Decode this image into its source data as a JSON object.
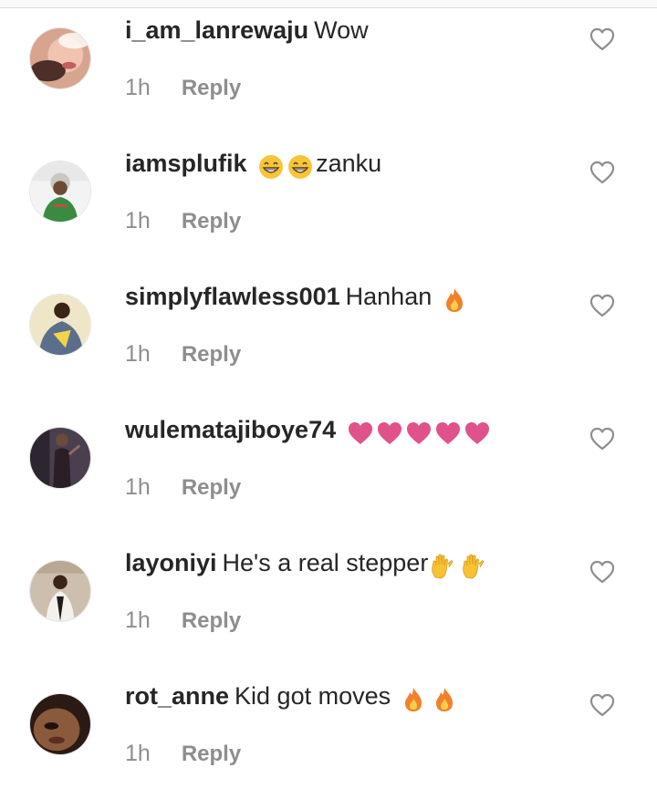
{
  "colors": {
    "username": "#262626",
    "text": "#262626",
    "meta": "#8e8e8e",
    "heart_outline": "#8e8e8e",
    "heart_emoji": "#e0528a",
    "fire": "#f2802a",
    "raised_hand": "#f7c234",
    "grin_emoji": "#f6c53a"
  },
  "comments": [
    {
      "username": "i_am_lanrewaju",
      "text": "Wow",
      "time": "1h",
      "reply_label": "Reply",
      "emojis_after": [],
      "avatar_icon": "avatar-icon",
      "like_icon": "heart-outline-icon"
    },
    {
      "username": "iamsplufik",
      "text": "zanku",
      "time": "1h",
      "reply_label": "Reply",
      "emojis_before": [
        "grinning-face-emoji",
        "grinning-face-emoji"
      ],
      "emojis_after": [],
      "avatar_icon": "avatar-icon",
      "like_icon": "heart-outline-icon"
    },
    {
      "username": "simplyflawless001",
      "text": "Hanhan",
      "time": "1h",
      "reply_label": "Reply",
      "emojis_after": [
        "fire-emoji"
      ],
      "avatar_icon": "avatar-icon",
      "like_icon": "heart-outline-icon"
    },
    {
      "username": "wulematajiboye74",
      "text": "",
      "time": "1h",
      "reply_label": "Reply",
      "emojis_after": [
        "heart-emoji",
        "heart-emoji",
        "heart-emoji",
        "heart-emoji",
        "heart-emoji"
      ],
      "avatar_icon": "avatar-icon",
      "like_icon": "heart-outline-icon"
    },
    {
      "username": "layoniyi",
      "text": "He's a real stepper",
      "time": "1h",
      "reply_label": "Reply",
      "emojis_after": [
        "raised-hand-emoji",
        "raised-hand-emoji"
      ],
      "avatar_icon": "avatar-icon",
      "like_icon": "heart-outline-icon"
    },
    {
      "username": "rot_anne",
      "text": "Kid got moves",
      "time": "1h",
      "reply_label": "Reply",
      "emojis_after": [
        "fire-emoji",
        "fire-emoji"
      ],
      "avatar_icon": "avatar-icon",
      "like_icon": "heart-outline-icon"
    }
  ]
}
